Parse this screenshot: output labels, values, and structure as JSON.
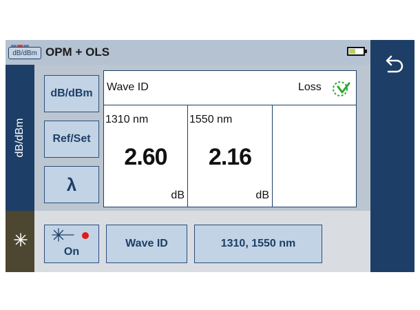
{
  "titlebar": {
    "mode_badge": "dB/dBm",
    "title": "OPM + OLS",
    "battery_icon": "battery-icon"
  },
  "side_tabs": {
    "units_tab": "dB/dBm",
    "light_tab_icon": "light-source-icon"
  },
  "left_buttons": {
    "units": "dB/dBm",
    "refset": "Ref/Set",
    "lambda": "λ"
  },
  "results": {
    "wave_id_label": "Wave ID",
    "loss_label": "Loss",
    "loss_icon": "loss-pass-check-icon",
    "cells": [
      {
        "wavelength": "1310 nm",
        "value": "2.60",
        "unit": "dB"
      },
      {
        "wavelength": "1550 nm",
        "value": "2.16",
        "unit": "dB"
      }
    ]
  },
  "bottom": {
    "source_label": "On",
    "source_indicator_color": "#e01b1b",
    "wave_id_button": "Wave ID",
    "wavelengths_button": "1310, 1550 nm"
  },
  "colors": {
    "accent_dark": "#1d3e66",
    "button_fill": "#c2d3e6",
    "panel_bg": "#bcc6d0",
    "light_tab_bg": "#4d4630"
  }
}
